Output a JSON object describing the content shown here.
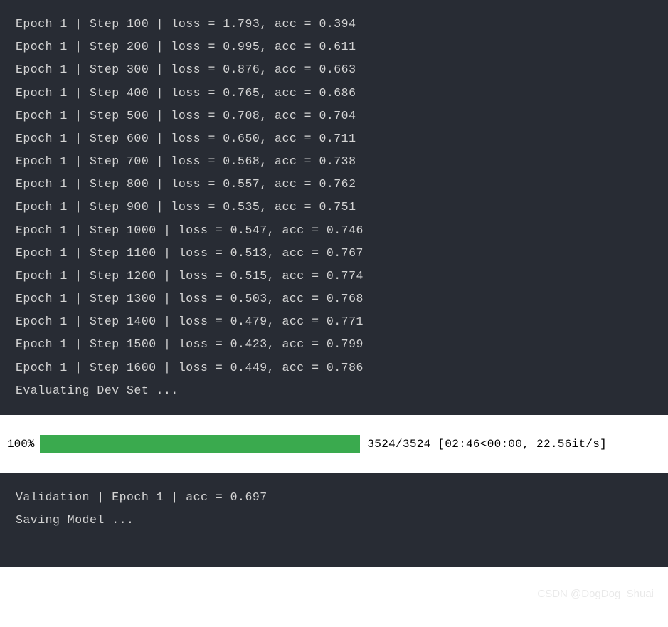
{
  "training_log": {
    "lines": [
      "Epoch 1 | Step 100 | loss = 1.793, acc = 0.394",
      "Epoch 1 | Step 200 | loss = 0.995, acc = 0.611",
      "Epoch 1 | Step 300 | loss = 0.876, acc = 0.663",
      "Epoch 1 | Step 400 | loss = 0.765, acc = 0.686",
      "Epoch 1 | Step 500 | loss = 0.708, acc = 0.704",
      "Epoch 1 | Step 600 | loss = 0.650, acc = 0.711",
      "Epoch 1 | Step 700 | loss = 0.568, acc = 0.738",
      "Epoch 1 | Step 800 | loss = 0.557, acc = 0.762",
      "Epoch 1 | Step 900 | loss = 0.535, acc = 0.751",
      "Epoch 1 | Step 1000 | loss = 0.547, acc = 0.746",
      "Epoch 1 | Step 1100 | loss = 0.513, acc = 0.767",
      "Epoch 1 | Step 1200 | loss = 0.515, acc = 0.774",
      "Epoch 1 | Step 1300 | loss = 0.503, acc = 0.768",
      "Epoch 1 | Step 1400 | loss = 0.479, acc = 0.771",
      "Epoch 1 | Step 1500 | loss = 0.423, acc = 0.799",
      "Epoch 1 | Step 1600 | loss = 0.449, acc = 0.786",
      "Evaluating Dev Set ..."
    ]
  },
  "progress": {
    "percent": "100%",
    "current": "3524",
    "total": "3524",
    "elapsed": "02:46",
    "remaining": "00:00",
    "rate": "22.56it/s",
    "text": "3524/3524 [02:46<00:00, 22.56it/s]"
  },
  "validation_log": {
    "lines": [
      "Validation | Epoch 1 | acc = 0.697",
      "Saving Model ..."
    ]
  },
  "watermark": "CSDN @DogDog_Shuai"
}
